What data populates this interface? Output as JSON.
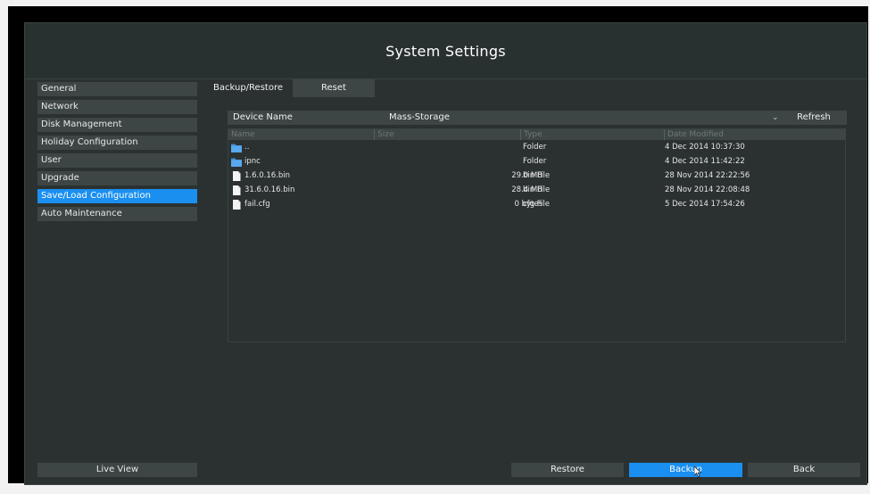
{
  "window": {
    "title": "System Settings"
  },
  "sidebar": {
    "items": [
      {
        "label": "General"
      },
      {
        "label": "Network"
      },
      {
        "label": "Disk Management"
      },
      {
        "label": "Holiday Configuration"
      },
      {
        "label": "User"
      },
      {
        "label": "Upgrade"
      },
      {
        "label": "Save/Load Configuration",
        "active": true
      },
      {
        "label": "Auto Maintenance"
      }
    ],
    "live_view_label": "Live View"
  },
  "tabs": [
    {
      "label": "Backup/Restore",
      "active": true
    },
    {
      "label": "Reset"
    }
  ],
  "device": {
    "label": "Device Name",
    "value": "Mass-Storage",
    "dropdown_icon": "caret-down",
    "refresh_label": "Refresh"
  },
  "file_table": {
    "columns": [
      "Name",
      "Size",
      "Type",
      "Date Modified"
    ],
    "rows": [
      {
        "icon": "folder-icon",
        "name": "..",
        "size": "",
        "type": "Folder",
        "date": "4 Dec 2014 10:37:30"
      },
      {
        "icon": "folder-icon",
        "name": "ipnc",
        "size": "",
        "type": "Folder",
        "date": "4 Dec 2014 11:42:22"
      },
      {
        "icon": "file-icon",
        "name": "1.6.0.16.bin",
        "size": "29.0 MB",
        "type": "bin File",
        "date": "28 Nov 2014 22:22:56"
      },
      {
        "icon": "file-icon",
        "name": "31.6.0.16.bin",
        "size": "28.4 MB",
        "type": "bin File",
        "date": "28 Nov 2014 22:08:48"
      },
      {
        "icon": "file-icon",
        "name": "fail.cfg",
        "size": "0 bytes",
        "type": "cfg File",
        "date": "5 Dec 2014 17:54:26"
      }
    ]
  },
  "buttons": {
    "restore": "Restore",
    "backup": "Backup",
    "back": "Back"
  },
  "colors": {
    "accent": "#1a8ff0",
    "panel": "#2b3131",
    "control": "#3d4545"
  }
}
